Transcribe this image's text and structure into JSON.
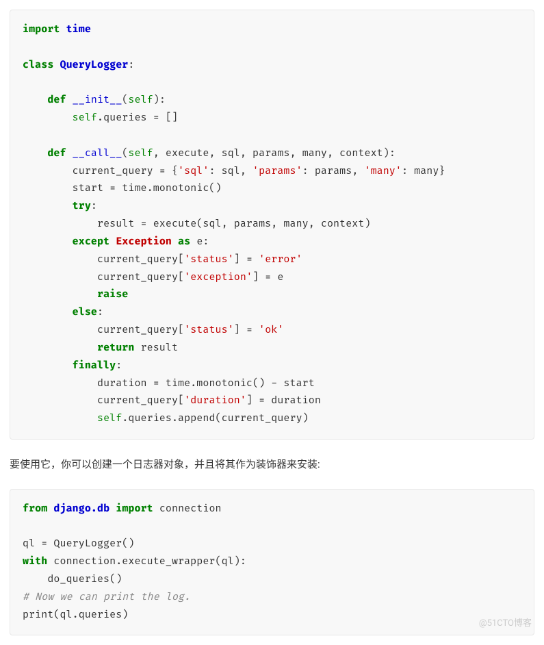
{
  "block1": {
    "l1_import": "import",
    "l1_time": "time",
    "l3_class": "class",
    "l3_name": "QueryLogger",
    "l5_def": "def",
    "l5_init": "__init__",
    "l5_self": "self",
    "l6_self": "self",
    "l6_rest": ".queries = []",
    "l8_def": "def",
    "l8_call": "__call__",
    "l8_self": "self",
    "l8_rest": ", execute, sql, params, many, context):",
    "l9_lhs": "current_query = {",
    "l9_s1": "'sql'",
    "l9_m1": ": sql, ",
    "l9_s2": "'params'",
    "l9_m2": ": params, ",
    "l9_s3": "'many'",
    "l9_m3": ": many}",
    "l10": "start = time.monotonic()",
    "l11_try": "try",
    "l12": "result = execute(sql, params, many, context)",
    "l13_except": "except",
    "l13_exc": "Exception",
    "l13_as": "as",
    "l13_e": " e:",
    "l14_a": "current_query[",
    "l14_s1": "'status'",
    "l14_b": "] = ",
    "l14_s2": "'error'",
    "l15_a": "current_query[",
    "l15_s1": "'exception'",
    "l15_b": "] = e",
    "l16_raise": "raise",
    "l17_else": "else",
    "l18_a": "current_query[",
    "l18_s1": "'status'",
    "l18_b": "] = ",
    "l18_s2": "'ok'",
    "l19_return": "return",
    "l19_rest": " result",
    "l20_finally": "finally",
    "l21": "duration = time.monotonic() - start",
    "l22_a": "current_query[",
    "l22_s1": "'duration'",
    "l22_b": "] = duration",
    "l23_self": "self",
    "l23_rest": ".queries.append(current_query)"
  },
  "paragraph": "要使用它，你可以创建一个日志器对象，并且将其作为装饰器来安装:",
  "block2": {
    "l1_from": "from",
    "l1_mod": "django.db",
    "l1_import": "import",
    "l1_conn": " connection",
    "l3": "ql = QueryLogger()",
    "l4_with": "with",
    "l4_rest": " connection.execute_wrapper(ql):",
    "l5": "do_queries()",
    "l6_comment": "# Now we can print the log.",
    "l7": "print(ql.queries)"
  },
  "watermark": "@51CTO博客"
}
